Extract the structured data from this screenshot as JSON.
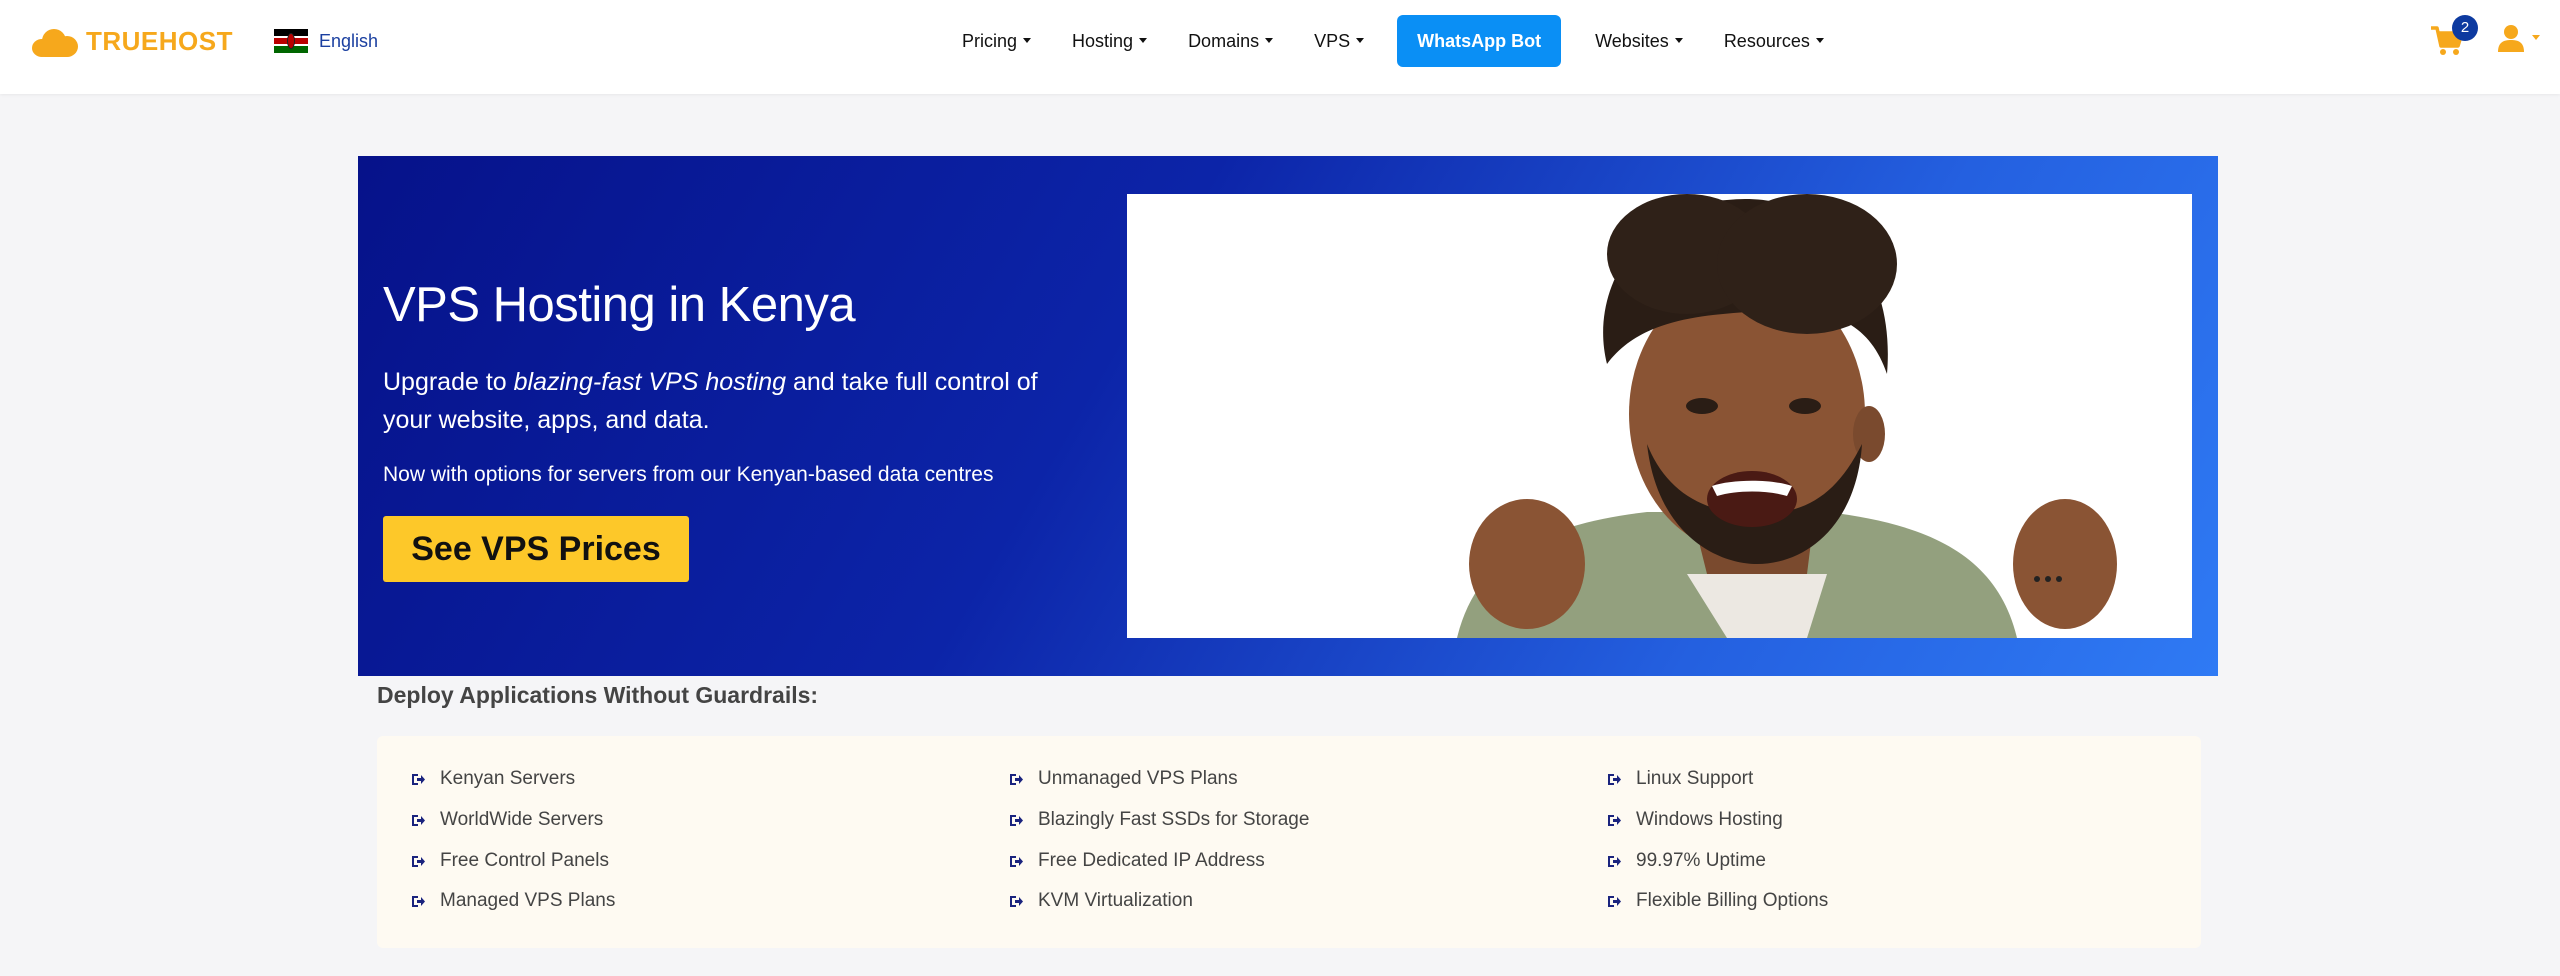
{
  "header": {
    "logo_text": "TRUEHOST",
    "language": "English",
    "nav": [
      {
        "label": "Pricing"
      },
      {
        "label": "Hosting"
      },
      {
        "label": "Domains"
      },
      {
        "label": "VPS"
      }
    ],
    "cta_label": "WhatsApp Bot",
    "nav_right": [
      {
        "label": "Websites"
      },
      {
        "label": "Resources"
      }
    ],
    "cart_count": "2",
    "icons": {
      "cart": "cart-icon",
      "user": "user-icon",
      "logo": "cloud-icon",
      "flag": "kenya-flag-icon"
    }
  },
  "hero": {
    "title": "VPS Hosting in Kenya",
    "subtitle_pre": "Upgrade to ",
    "subtitle_em": "blazing-fast VPS hosting",
    "subtitle_post": " and take full control of your website, apps, and data.",
    "note": "Now with options for servers from our Kenyan-based data centres",
    "cta": "See VPS Prices"
  },
  "features": {
    "heading": "Deploy Applications Without Guardrails:",
    "columns": [
      [
        "Kenyan Servers",
        "WorldWide Servers",
        "Free Control Panels",
        "Managed VPS Plans"
      ],
      [
        "Unmanaged VPS Plans",
        "Blazingly Fast SSDs for Storage",
        "Free Dedicated IP Address",
        "KVM Virtualization"
      ],
      [
        "Linux Support",
        "Windows Hosting",
        "99.97% Uptime",
        "Flexible Billing Options"
      ]
    ]
  },
  "colors": {
    "brand": "#f6a81c",
    "cta": "#0a8ff5",
    "hero_dark": "#06128a",
    "hero_light": "#2f7af4",
    "button_yellow": "#fdc829"
  }
}
